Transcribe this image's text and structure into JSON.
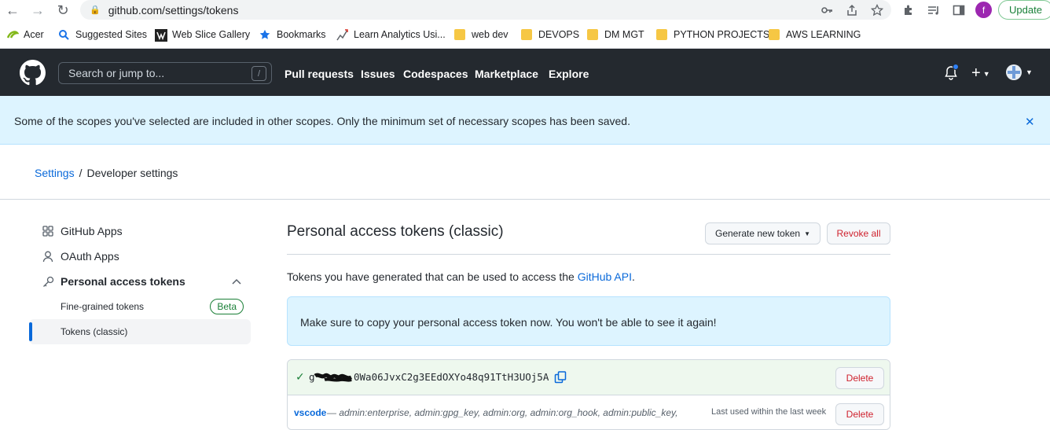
{
  "browser": {
    "url": "github.com/settings/tokens",
    "profile_initial": "f",
    "update_label": "Update"
  },
  "bookmarks": [
    {
      "label": "Acer",
      "icon": "acer-icon"
    },
    {
      "label": "Suggested Sites",
      "icon": "search-icon"
    },
    {
      "label": "Web Slice Gallery",
      "icon": "web-slice-icon"
    },
    {
      "label": "Bookmarks",
      "icon": "star-icon"
    },
    {
      "label": "Learn Analytics Usi...",
      "icon": "analytics-icon"
    },
    {
      "label": "web dev",
      "icon": "folder-icon"
    },
    {
      "label": "DEVOPS",
      "icon": "folder-icon"
    },
    {
      "label": "DM MGT",
      "icon": "folder-icon"
    },
    {
      "label": "PYTHON PROJECTS",
      "icon": "folder-icon"
    },
    {
      "label": "AWS LEARNING",
      "icon": "folder-icon"
    }
  ],
  "header": {
    "search_placeholder": "Search or jump to...",
    "search_key": "/",
    "nav": [
      "Pull requests",
      "Issues",
      "Codespaces",
      "Marketplace",
      "Explore"
    ]
  },
  "flash": {
    "message": "Some of the scopes you've selected are included in other scopes. Only the minimum set of necessary scopes has been saved.",
    "close": "✕"
  },
  "breadcrumb": {
    "root": "Settings",
    "sep": "/",
    "current": "Developer settings"
  },
  "sidebar": {
    "github_apps": "GitHub Apps",
    "oauth_apps": "OAuth Apps",
    "personal_tokens": "Personal access tokens",
    "fine_grained": "Fine-grained tokens",
    "beta": "Beta",
    "classic": "Tokens (classic)"
  },
  "main": {
    "title": "Personal access tokens (classic)",
    "generate_label": "Generate new token",
    "revoke_label": "Revoke all",
    "intro_prefix": "Tokens you have generated that can be used to access the ",
    "intro_link": "GitHub API",
    "intro_suffix": ".",
    "copy_notice": "Make sure to copy your personal access token now. You won't be able to see it again!",
    "token_prefix": "g",
    "token_value": "0Wa06JvxC2g3EEdOXYo48q91TtH3UOj5A",
    "delete_label": "Delete",
    "token_name": "vscode",
    "token_scopes": "— admin:enterprise, admin:gpg_key, admin:org, admin:org_hook, admin:public_key,",
    "last_used": "Last used within the last week"
  }
}
